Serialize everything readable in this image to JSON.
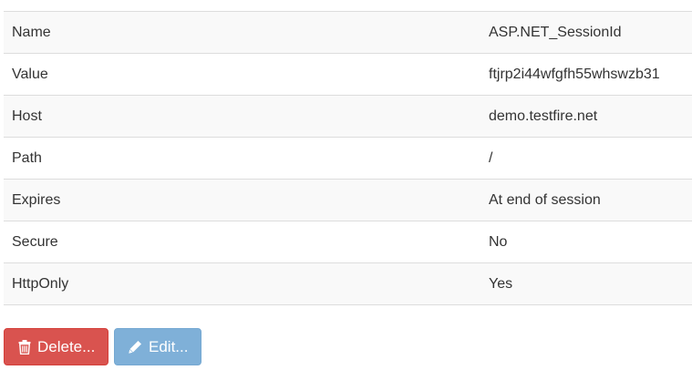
{
  "properties": [
    {
      "key": "Name",
      "value": "ASP.NET_SessionId"
    },
    {
      "key": "Value",
      "value": "ftjrp2i44wfgfh55whswzb31"
    },
    {
      "key": "Host",
      "value": "demo.testfire.net"
    },
    {
      "key": "Path",
      "value": "/"
    },
    {
      "key": "Expires",
      "value": "At end of session"
    },
    {
      "key": "Secure",
      "value": "No"
    },
    {
      "key": "HttpOnly",
      "value": "Yes"
    }
  ],
  "actions": {
    "delete_label": "Delete...",
    "edit_label": "Edit...",
    "delete_icon": "trash-icon",
    "edit_icon": "pencil-icon",
    "delete_color": "#d9534f",
    "edit_color": "#7fb0d8"
  }
}
